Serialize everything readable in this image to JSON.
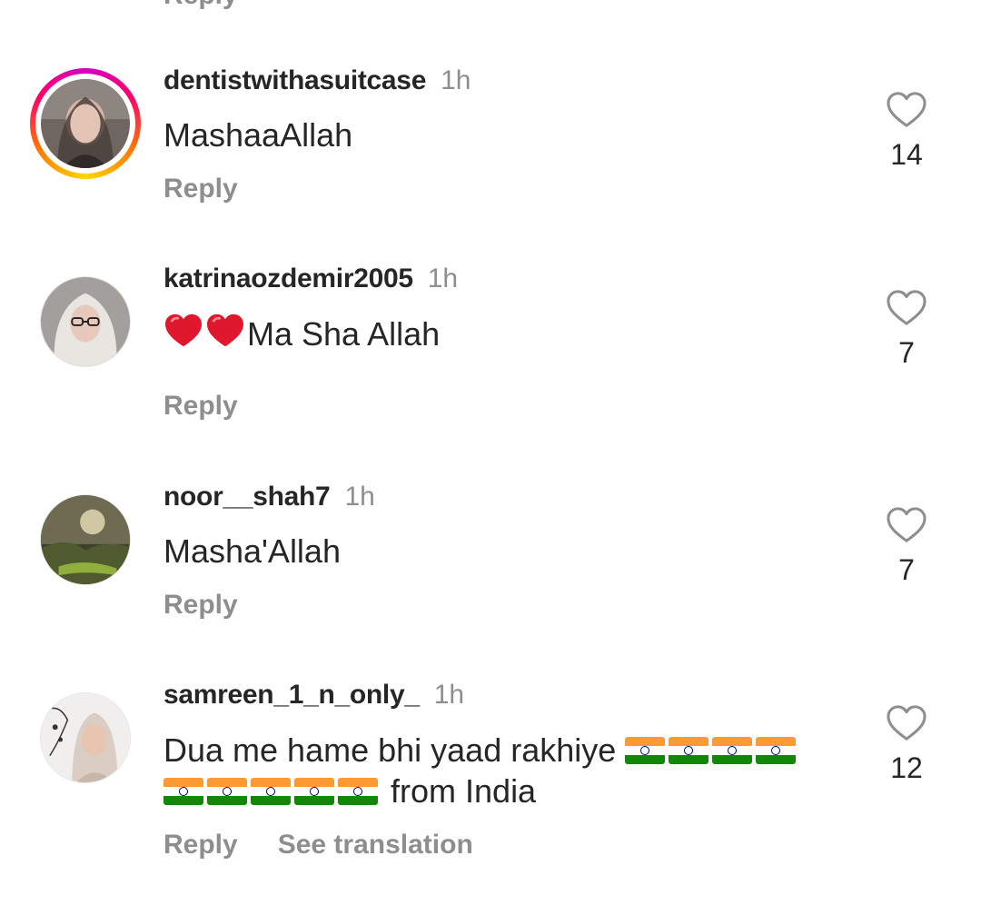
{
  "partial_reply_label": "Reply",
  "comments": [
    {
      "username": "dentistwithasuitcase",
      "time": "1h",
      "text": "MashaaAllah",
      "likes": "14",
      "reply_label": "Reply",
      "has_story": true
    },
    {
      "username": "katrinaozdemir2005",
      "time": "1h",
      "emoji": "❤️❤️",
      "text": "Ma Sha Allah",
      "likes": "7",
      "reply_label": "Reply",
      "has_story": false
    },
    {
      "username": "noor__shah7",
      "time": "1h",
      "text": "Masha'Allah",
      "likes": "7",
      "reply_label": "Reply",
      "has_story": false
    },
    {
      "username": "samreen_1_n_only_",
      "time": "1h",
      "text_part1": "Dua me hame bhi yaad rakhiye",
      "text_part2": "from India",
      "flags_line1": 4,
      "flags_line2": 5,
      "flag_icon": "india-flag-icon",
      "likes": "12",
      "reply_label": "Reply",
      "see_translation_label": "See translation",
      "has_story": false
    }
  ],
  "colors": {
    "primary_text": "#262626",
    "secondary_text": "#8e8e8e",
    "heart_emoji": "#e0182d"
  },
  "icons": {
    "like": "heart-outline-icon",
    "emoji_heart": "red-heart-emoji-icon"
  }
}
